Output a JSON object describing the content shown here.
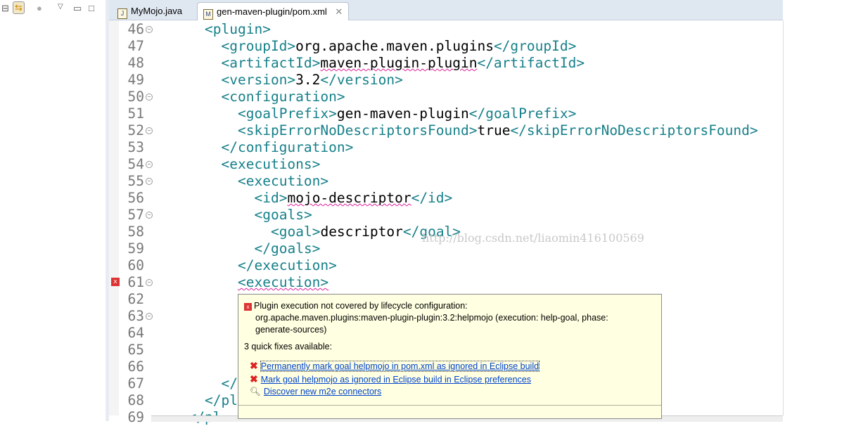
{
  "left_toolbar": {
    "icons": [
      "collapse-all-icon",
      "link-with-editor-icon",
      "focus-icon",
      "view-menu-icon",
      "minimize-icon",
      "maximize-icon"
    ]
  },
  "tabs": [
    {
      "label": "MyMojo.java",
      "icon": "J"
    },
    {
      "label": "gen-maven-plugin/pom.xml",
      "icon": "M"
    }
  ],
  "lines": [
    {
      "n": "46",
      "fold": true,
      "code": [
        [
          "t",
          "<plugin>"
        ]
      ],
      "indent": 0
    },
    {
      "n": "47",
      "code": [
        [
          "t",
          "<groupId>"
        ],
        [
          "",
          "org.apache.maven.plugins"
        ],
        [
          "t",
          "</groupId>"
        ]
      ],
      "indent": 1
    },
    {
      "n": "48",
      "code": [
        [
          "t",
          "<artifactId>"
        ],
        [
          "s",
          "maven-plugin-plugin"
        ],
        [
          "t",
          "</artifactId>"
        ]
      ],
      "indent": 1
    },
    {
      "n": "49",
      "code": [
        [
          "t",
          "<version>"
        ],
        [
          "",
          "3.2"
        ],
        [
          "t",
          "</version>"
        ]
      ],
      "indent": 1
    },
    {
      "n": "50",
      "fold": true,
      "code": [
        [
          "t",
          "<configuration>"
        ]
      ],
      "indent": 1
    },
    {
      "n": "51",
      "code": [
        [
          "t",
          "<goalPrefix>"
        ],
        [
          "",
          "gen-maven-plugin"
        ],
        [
          "t",
          "</goalPrefix>"
        ]
      ],
      "indent": 2
    },
    {
      "n": "52",
      "fold": true,
      "code": [
        [
          "t",
          "<skipErrorNoDescriptorsFound>"
        ],
        [
          "",
          "true"
        ],
        [
          "t",
          "</skipErrorNoDescriptorsFound>"
        ]
      ],
      "indent": 2
    },
    {
      "n": "53",
      "code": [
        [
          "t",
          "</configuration>"
        ]
      ],
      "indent": 1
    },
    {
      "n": "54",
      "fold": true,
      "code": [
        [
          "t",
          "<executions>"
        ]
      ],
      "indent": 1
    },
    {
      "n": "55",
      "fold": true,
      "code": [
        [
          "t",
          "<execution>"
        ]
      ],
      "indent": 2
    },
    {
      "n": "56",
      "code": [
        [
          "t",
          "<id>"
        ],
        [
          "s",
          "mojo-descriptor"
        ],
        [
          "t",
          "</id>"
        ]
      ],
      "indent": 3
    },
    {
      "n": "57",
      "fold": true,
      "code": [
        [
          "t",
          "<goals>"
        ]
      ],
      "indent": 3
    },
    {
      "n": "58",
      "code": [
        [
          "t",
          "<goal>"
        ],
        [
          "",
          "descriptor"
        ],
        [
          "t",
          "</goal>"
        ]
      ],
      "indent": 4
    },
    {
      "n": "59",
      "code": [
        [
          "t",
          "</goals>"
        ]
      ],
      "indent": 3
    },
    {
      "n": "60",
      "code": [
        [
          "t",
          "</execution>"
        ]
      ],
      "indent": 2
    },
    {
      "n": "61",
      "fold": true,
      "marker": true,
      "code": [
        [
          "ts",
          "<execution>"
        ]
      ],
      "indent": 2
    },
    {
      "n": "62",
      "code": [],
      "indent": 2
    },
    {
      "n": "63",
      "fold": true,
      "code": [],
      "indent": 2
    },
    {
      "n": "64",
      "code": [],
      "indent": 2
    },
    {
      "n": "65",
      "code": [],
      "indent": 2
    },
    {
      "n": "66",
      "code": [],
      "indent": 2
    },
    {
      "n": "67",
      "code": [
        [
          "t",
          "</"
        ]
      ],
      "indent": 1
    },
    {
      "n": "68",
      "code": [
        [
          "t",
          "</pl"
        ]
      ],
      "indent": 0
    },
    {
      "n": "69",
      "code": [
        [
          "t",
          "</pl"
        ]
      ],
      "indent": -1
    }
  ],
  "watermark": "http://blog.csdn.net/liaomin416100569",
  "tooltip": {
    "message": "Plugin execution not covered by lifecycle configuration:",
    "detail1": "org.apache.maven.plugins:maven-plugin-plugin:3.2:helpmojo (execution: help-goal, phase:",
    "detail2": "generate-sources)",
    "fixes_header": "3 quick fixes available:",
    "fixes": [
      {
        "label": "Permanently mark goal helpmojo in pom.xml as ignored in Eclipse build",
        "icon": "error-x-icon"
      },
      {
        "label": "Mark goal helpmojo as ignored in Eclipse build in Eclipse preferences",
        "icon": "error-x-icon"
      },
      {
        "label": "Discover new m2e connectors",
        "icon": "search-icon"
      }
    ]
  },
  "colors": {
    "tag": "#17808a",
    "link": "#0044cc",
    "tooltip_bg": "#ffffe1"
  }
}
